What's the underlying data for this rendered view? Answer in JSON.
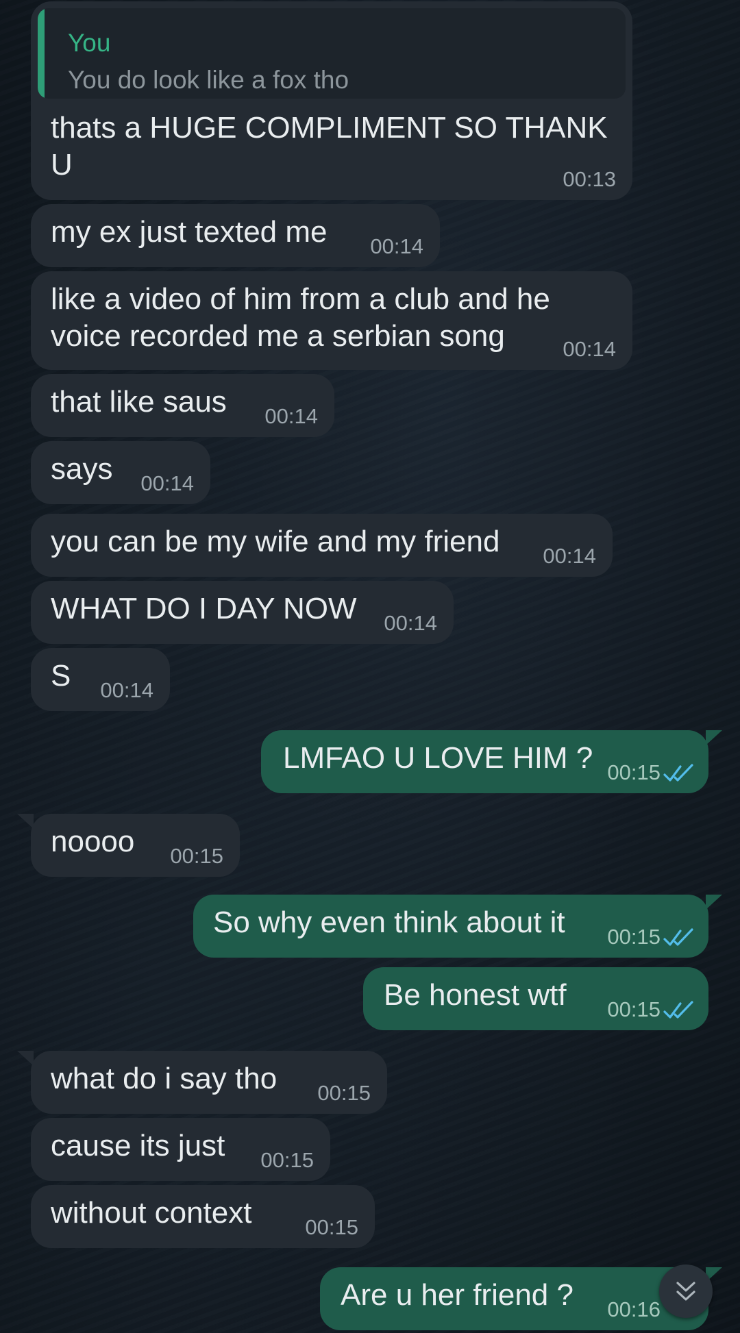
{
  "theme": {
    "incoming_bg": "#242b33",
    "outgoing_bg": "#1f5c4b",
    "read_tick_color": "#53bdeb",
    "quote_accent": "#2e9e77"
  },
  "reply_quote": {
    "author": "You",
    "text": "You do look like a fox tho"
  },
  "messages": [
    {
      "dir": "in",
      "text": "thats a HUGE COMPLIMENT SO THANK\nU",
      "time": "00:13"
    },
    {
      "dir": "in",
      "text": "my ex just texted me",
      "time": "00:14"
    },
    {
      "dir": "in",
      "text": "like a video of him from a club and he\nvoice recorded me a serbian song",
      "time": "00:14"
    },
    {
      "dir": "in",
      "text": "that like saus",
      "time": "00:14"
    },
    {
      "dir": "in",
      "text": "says",
      "time": "00:14"
    },
    {
      "dir": "in",
      "text": "you can be my wife and my friend",
      "time": "00:14"
    },
    {
      "dir": "in",
      "text": "WHAT DO I DAY NOW",
      "time": "00:14"
    },
    {
      "dir": "in",
      "text": "S",
      "time": "00:14"
    },
    {
      "dir": "out",
      "text": "LMFAO U LOVE HIM ?",
      "time": "00:15",
      "status_icon": "double-check-read"
    },
    {
      "dir": "in",
      "text": "noooo",
      "time": "00:15"
    },
    {
      "dir": "out",
      "text": "So why even think about it",
      "time": "00:15",
      "status_icon": "double-check-read"
    },
    {
      "dir": "out",
      "text": "Be honest wtf",
      "time": "00:15",
      "status_icon": "double-check-read"
    },
    {
      "dir": "in",
      "text": "what do i say tho",
      "time": "00:15"
    },
    {
      "dir": "in",
      "text": "cause its just",
      "time": "00:15"
    },
    {
      "dir": "in",
      "text": "without context",
      "time": "00:15"
    },
    {
      "dir": "out",
      "text": "Are u her friend ?",
      "time": "00:16"
    }
  ],
  "scroll_button": {
    "icon": "double-chevron-down-icon"
  }
}
